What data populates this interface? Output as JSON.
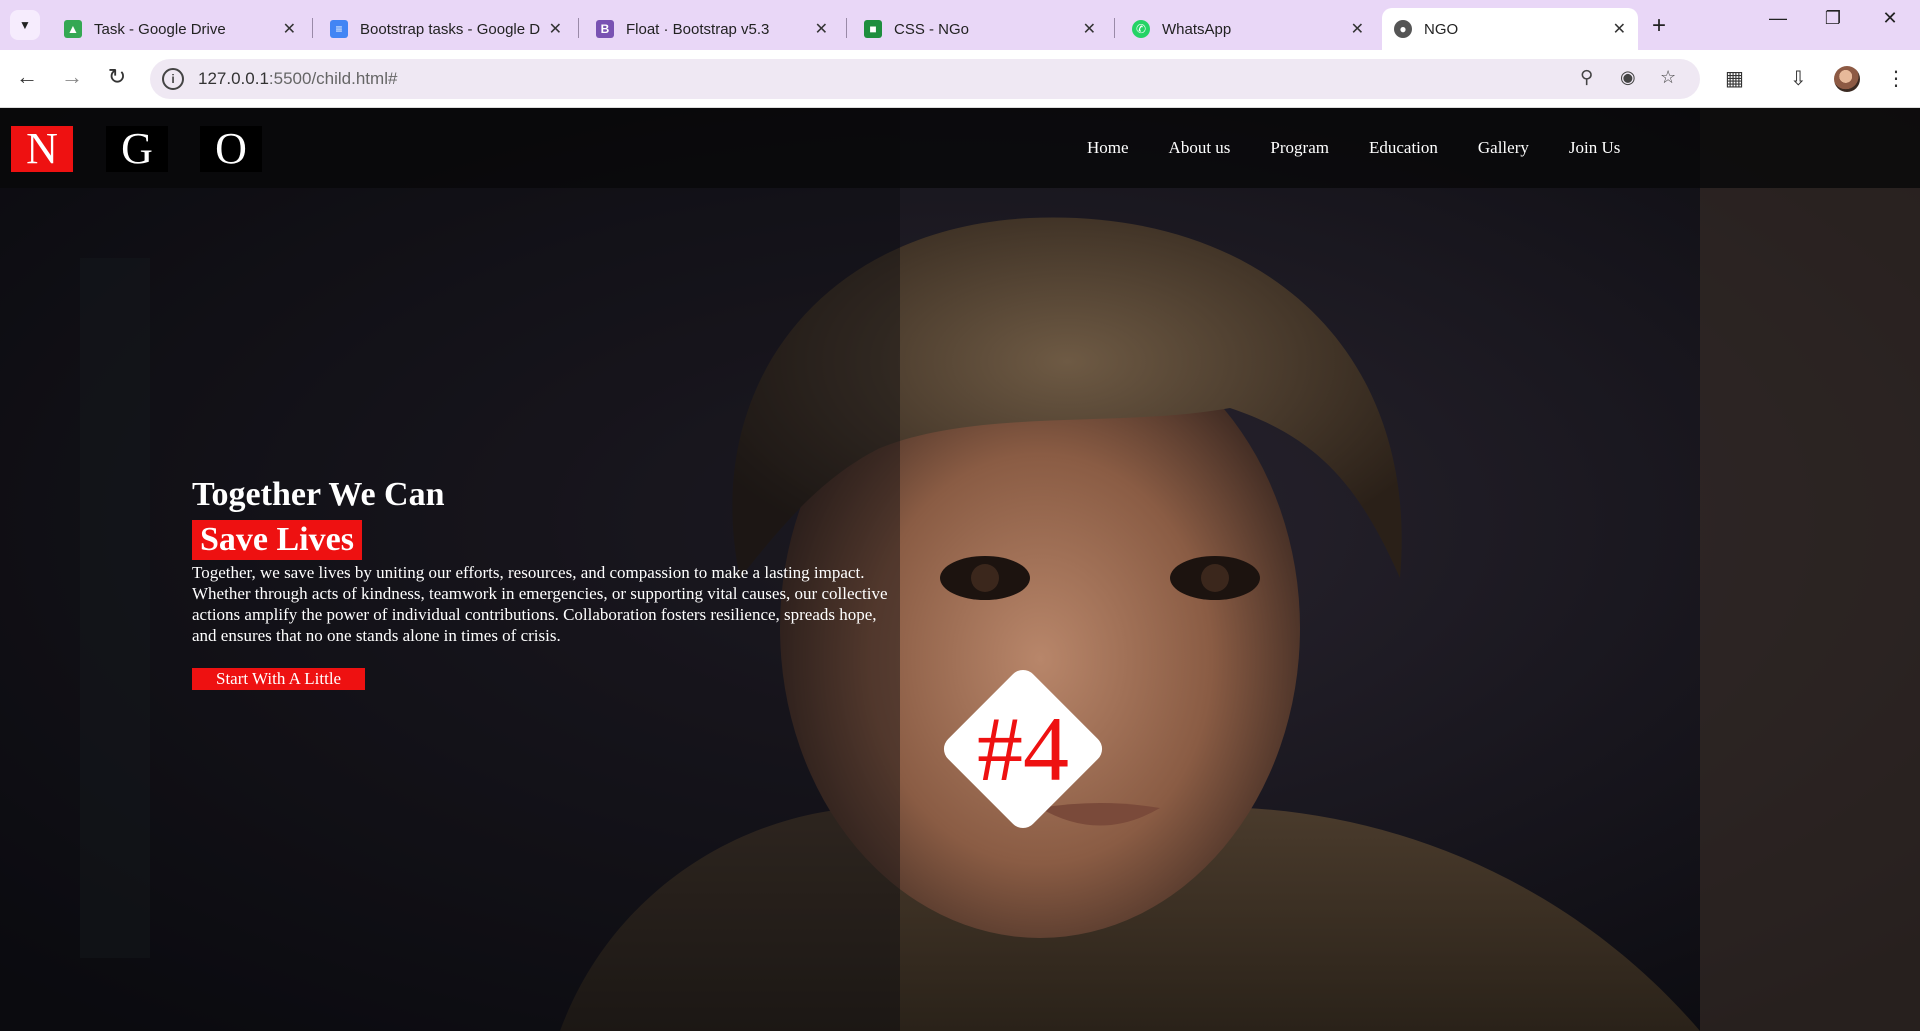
{
  "browser": {
    "tabs": [
      {
        "title": "Task - Google Drive",
        "icon": "google-drive-icon",
        "color": "#34a853"
      },
      {
        "title": "Bootstrap tasks - Google D",
        "icon": "google-docs-icon",
        "color": "#4285f4"
      },
      {
        "title": "Float · Bootstrap v5.3",
        "icon": "bootstrap-icon",
        "color": "#7952b3"
      },
      {
        "title": "CSS - NGo",
        "icon": "classroom-icon",
        "color": "#1e8e3e"
      },
      {
        "title": "WhatsApp",
        "icon": "whatsapp-icon",
        "color": "#25d366"
      },
      {
        "title": "NGO",
        "icon": "globe-icon",
        "color": "#555555"
      }
    ],
    "url_host": "127.0.0.1",
    "url_path": ":5500/child.html#"
  },
  "site": {
    "logo_letters": [
      "N",
      "G",
      "O"
    ],
    "nav": [
      "Home",
      "About us",
      "Program",
      "Education",
      "Gallery",
      "Join Us"
    ],
    "hero": {
      "heading": "Together We Can",
      "highlight": "Save Lives",
      "description": "Together, we save lives by uniting our efforts, resources, and compassion to make a lasting impact. Whether through acts of kindness, teamwork in emergencies, or supporting vital causes, our collective actions amplify the power of individual contributions. Collaboration fosters resilience, spreads hope, and ensures that no one stands alone in times of crisis.",
      "cta": "Start With A Little"
    },
    "badge": "#4",
    "colors": {
      "accent": "#ee1111",
      "navbar": "#08080a"
    }
  }
}
